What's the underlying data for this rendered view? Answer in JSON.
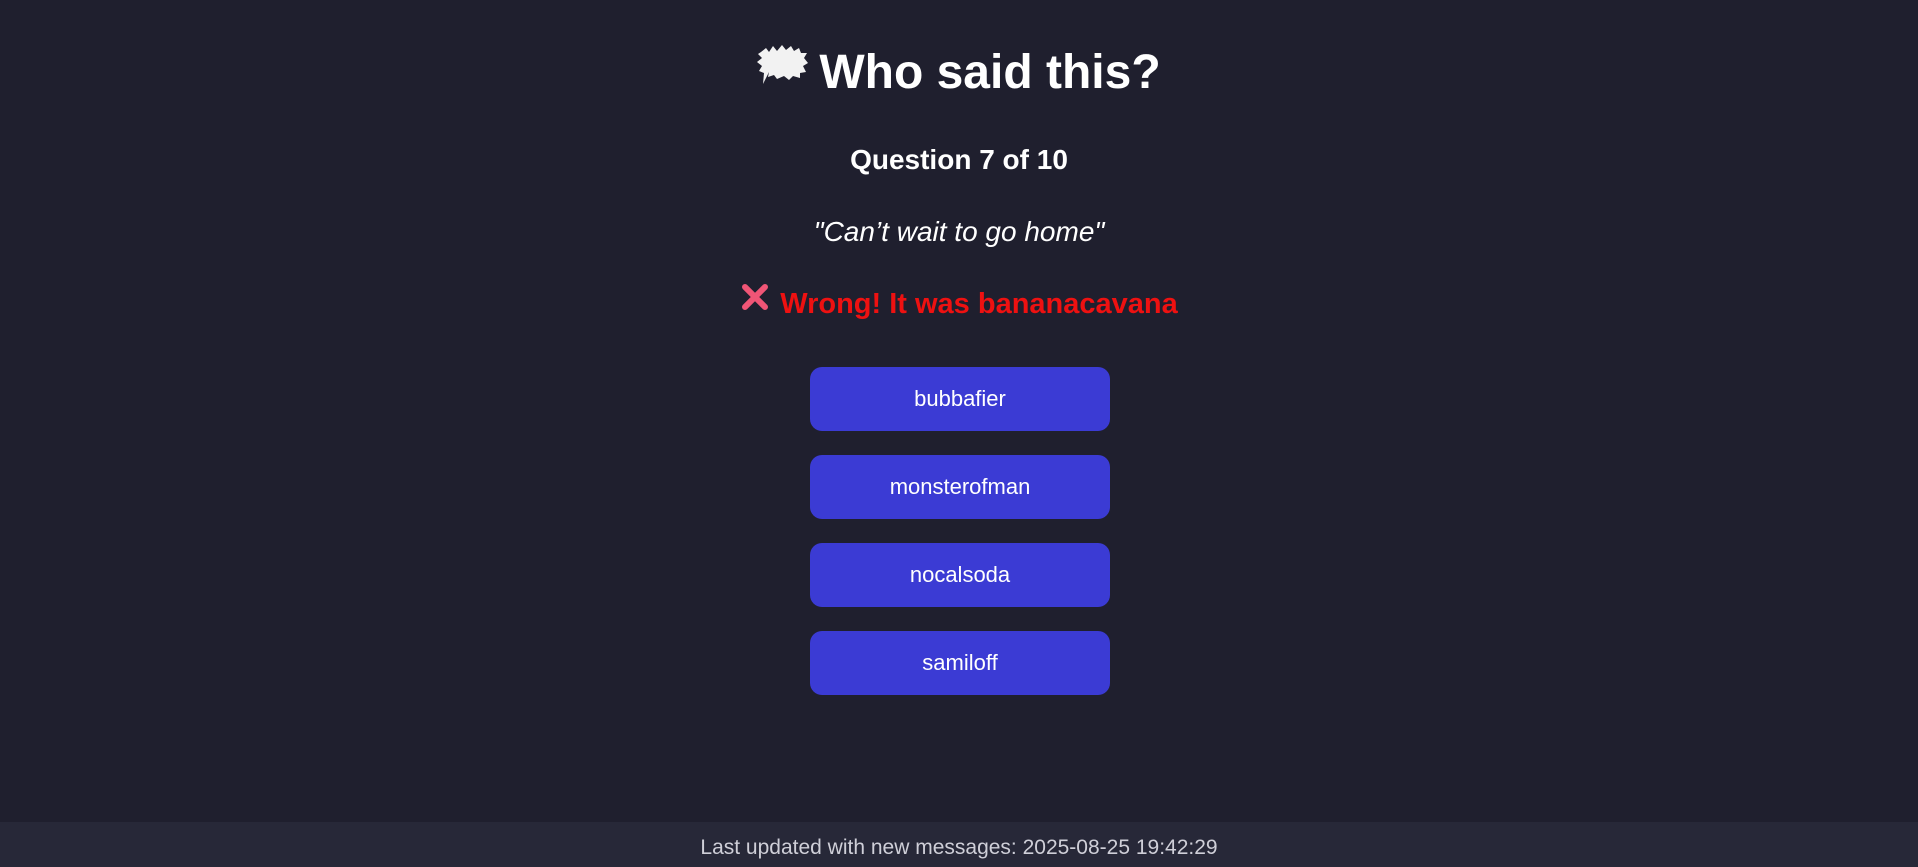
{
  "title": {
    "icon": "speech-bubble-icon",
    "text": "Who said this?"
  },
  "question": {
    "label": "Question 7 of 10"
  },
  "quote": {
    "text": "\"Can’t wait to go home\""
  },
  "feedback": {
    "icon": "cross-mark-icon",
    "text": "Wrong! It was bananacavana",
    "color": "#ee1111"
  },
  "options": [
    {
      "label": "bubbafier"
    },
    {
      "label": "monsterofman"
    },
    {
      "label": "nocalsoda"
    },
    {
      "label": "samiloff"
    }
  ],
  "footer": {
    "text": "Last updated with new messages: 2025-08-25 19:42:29"
  },
  "colors": {
    "background": "#1f1f2e",
    "button": "#3b3bd4",
    "footer_background": "#272838",
    "wrong": "#ee1111"
  }
}
